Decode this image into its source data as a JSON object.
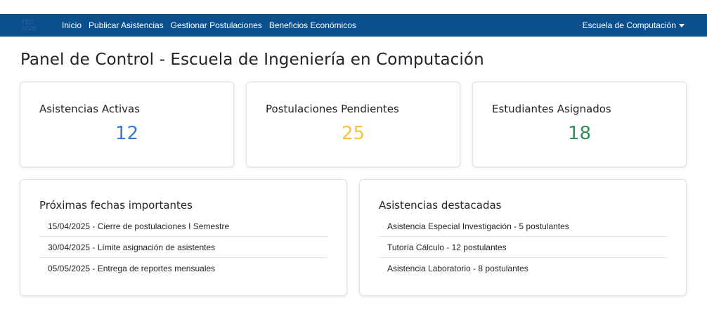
{
  "navbar": {
    "brand": "TEC 2026",
    "links": [
      "Inicio",
      "Publicar Asistencias",
      "Gestionar Postulaciones",
      "Beneficios Económicos"
    ],
    "user_menu": "Escuela de Computación"
  },
  "page_title": "Panel de Control - Escuela de Ingeniería en Computación",
  "stats": [
    {
      "label": "Asistencias Activas",
      "value": "12",
      "color": "#2f7de1"
    },
    {
      "label": "Postulaciones Pendientes",
      "value": "25",
      "color": "#f5c23e"
    },
    {
      "label": "Estudiantes Asignados",
      "value": "18",
      "color": "#2f8f57"
    }
  ],
  "dates": {
    "title": "Próximas fechas importantes",
    "items": [
      "15/04/2025 - Cierre de postulaciones I Semestre",
      "30/04/2025 - Límite asignación de asistentes",
      "05/05/2025 - Entrega de reportes mensuales"
    ]
  },
  "featured": {
    "title": "Asistencias destacadas",
    "items": [
      "Asistencia Especial Investigación - 5 postulantes",
      "Tutoría Cálculo - 12 postulantes",
      "Asistencia Laboratorio - 8 postulantes"
    ]
  }
}
